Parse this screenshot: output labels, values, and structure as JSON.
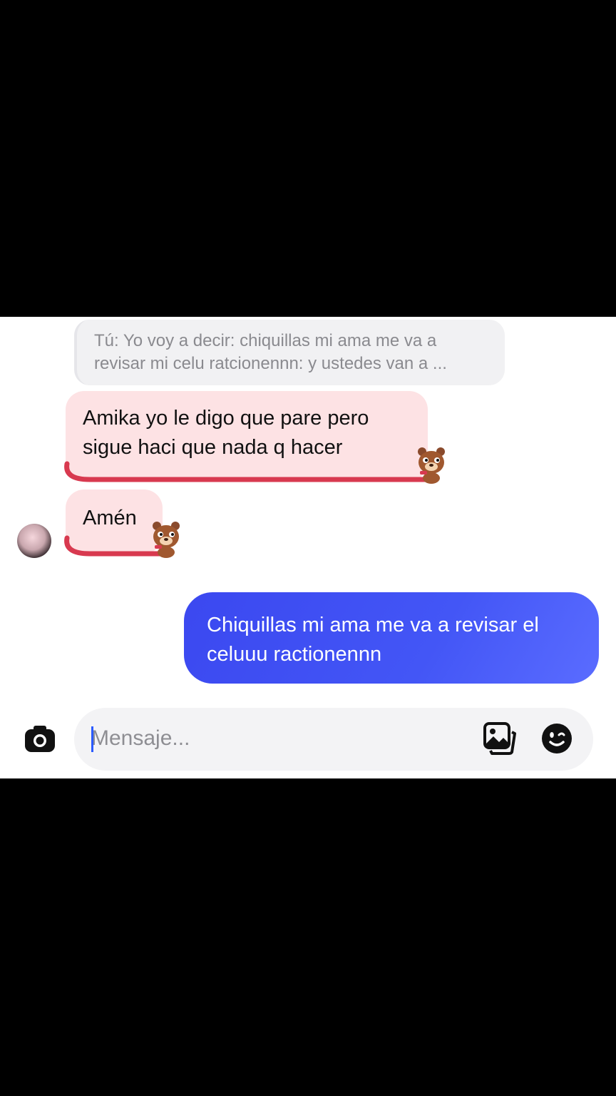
{
  "reply_preview": {
    "line1": "Tú: Yo voy a decir: chiquillas mi ama me va a",
    "line2": "revisar mi celu ratcionennn: y ustedes van a ..."
  },
  "messages": [
    {
      "direction": "incoming",
      "lines": [
        "Amika yo le digo que pare pero",
        "sigue haci que nada q hacer"
      ]
    },
    {
      "direction": "incoming",
      "lines": [
        "Amén"
      ]
    },
    {
      "direction": "outgoing",
      "lines": [
        "Chiquillas mi ama me va a revisar el",
        "celuuu ractionennn"
      ]
    }
  ],
  "composer": {
    "placeholder": "Mensaje..."
  },
  "icons": [
    "camera-icon",
    "gallery-icon",
    "sticker-icon",
    "bear-sticker-icon"
  ],
  "colors": {
    "incoming_bubble": "#fde2e4",
    "underline": "#d8394f",
    "outgoing_bubble": "#4356f6",
    "composer_bg": "#f3f3f5",
    "cursor": "#2b5bff"
  }
}
